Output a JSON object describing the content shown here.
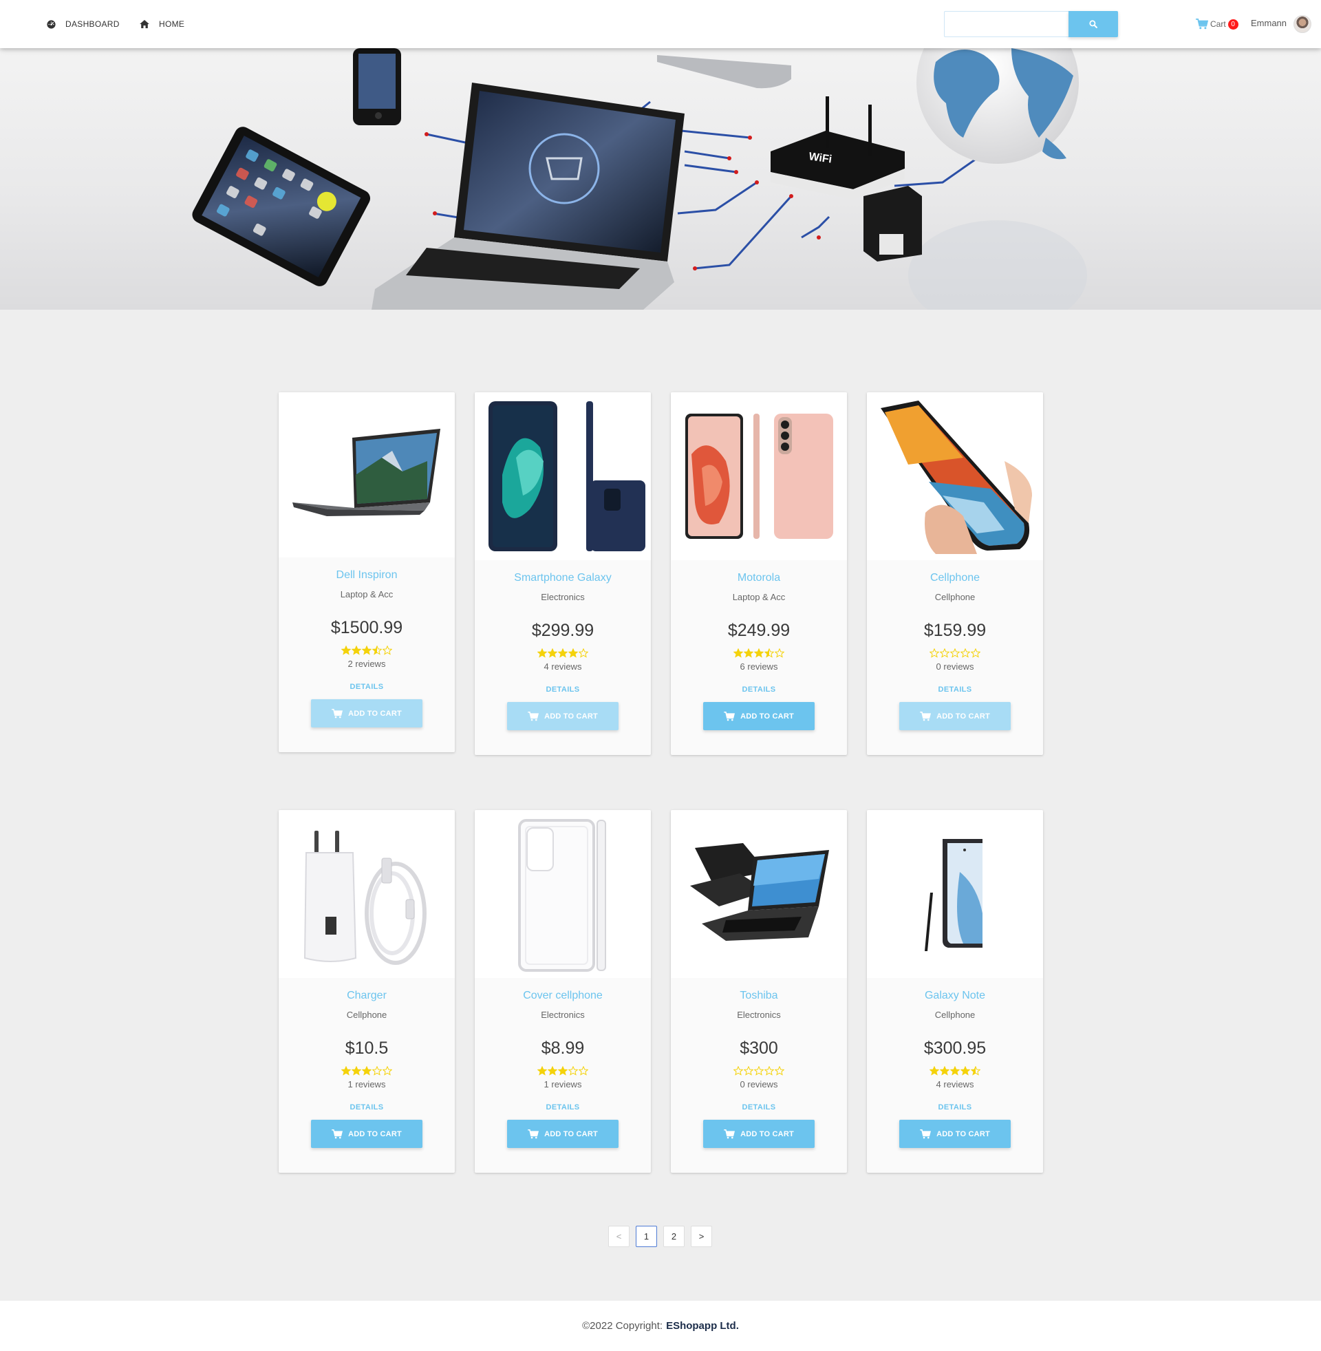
{
  "nav": {
    "dashboard_label": "DASHBOARD",
    "home_label": "HOME",
    "search_placeholder": "",
    "search_value": "",
    "cart_label": "Cart",
    "cart_count": "0",
    "user_name": "Emmann"
  },
  "colors": {
    "accent": "#6cc4ee",
    "accent_faded": "#a8dcf5",
    "badge": "#ff1b1b",
    "star": "#f4d20b",
    "page_bg": "#eeeeee"
  },
  "products": [
    {
      "name": "Dell Inspiron",
      "category": "Laptop & Acc",
      "price": "$1500.99",
      "rating": 3.5,
      "reviews": "2 reviews",
      "details": "DETAILS",
      "cart_label": "ADD TO CART",
      "button_state": "disabled"
    },
    {
      "name": "Smartphone Galaxy",
      "category": "Electronics",
      "price": "$299.99",
      "rating": 4,
      "reviews": "4 reviews",
      "details": "DETAILS",
      "cart_label": "ADD TO CART",
      "button_state": "disabled"
    },
    {
      "name": "Motorola",
      "category": "Laptop & Acc",
      "price": "$249.99",
      "rating": 3.5,
      "reviews": "6 reviews",
      "details": "DETAILS",
      "cart_label": "ADD TO CART",
      "button_state": "enabled"
    },
    {
      "name": "Cellphone",
      "category": "Cellphone",
      "price": "$159.99",
      "rating": 0,
      "reviews": "0 reviews",
      "details": "DETAILS",
      "cart_label": "ADD TO CART",
      "button_state": "disabled"
    },
    {
      "name": "Charger",
      "category": "Cellphone",
      "price": "$10.5",
      "rating": 3,
      "reviews": "1 reviews",
      "details": "DETAILS",
      "cart_label": "ADD TO CART",
      "button_state": "enabled"
    },
    {
      "name": "Cover cellphone",
      "category": "Electronics",
      "price": "$8.99",
      "rating": 3,
      "reviews": "1 reviews",
      "details": "DETAILS",
      "cart_label": "ADD TO CART",
      "button_state": "enabled"
    },
    {
      "name": "Toshiba",
      "category": "Electronics",
      "price": "$300",
      "rating": 0,
      "reviews": "0 reviews",
      "details": "DETAILS",
      "cart_label": "ADD TO CART",
      "button_state": "enabled"
    },
    {
      "name": "Galaxy Note",
      "category": "Cellphone",
      "price": "$300.95",
      "rating": 4.5,
      "reviews": "4 reviews",
      "details": "DETAILS",
      "cart_label": "ADD TO CART",
      "button_state": "enabled"
    }
  ],
  "pagination": {
    "prev": "<",
    "pages": [
      "1",
      "2"
    ],
    "current": "1",
    "next": ">"
  },
  "footer": {
    "copyright": "©2022 Copyright:",
    "company": "EShopapp Ltd."
  }
}
